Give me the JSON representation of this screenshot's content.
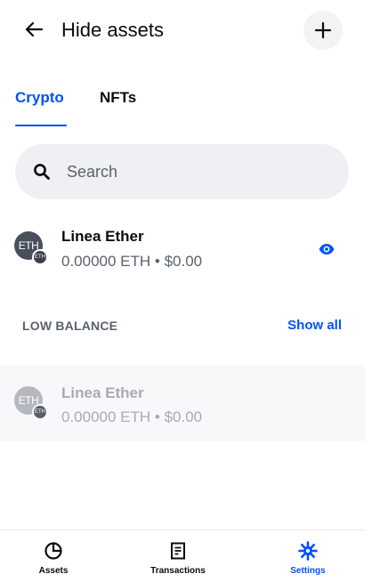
{
  "header": {
    "title": "Hide assets",
    "back_icon": "arrow-left-icon",
    "add_icon": "plus-icon"
  },
  "tabs": [
    {
      "label": "Crypto",
      "active": true
    },
    {
      "label": "NFTs",
      "active": false
    }
  ],
  "search": {
    "placeholder": "Search",
    "value": "",
    "icon": "search-icon"
  },
  "assets": [
    {
      "icon_text": "ETH",
      "network_text": "ETH",
      "name": "Linea Ether",
      "balance": "0.00000 ETH • $0.00",
      "visibility_icon": "eye-icon"
    }
  ],
  "low_balance": {
    "title": "LOW BALANCE",
    "show_all_label": "Show all",
    "assets": [
      {
        "icon_text": "ETH",
        "network_text": "ETH",
        "name": "Linea Ether",
        "balance": "0.00000 ETH • $0.00"
      }
    ]
  },
  "bottom_nav": [
    {
      "label": "Assets",
      "icon": "pie-chart-icon",
      "active": false
    },
    {
      "label": "Transactions",
      "icon": "document-icon",
      "active": false
    },
    {
      "label": "Settings",
      "icon": "gear-icon",
      "active": true
    }
  ],
  "colors": {
    "accent": "#0052ff",
    "text_primary": "#0a0b0d",
    "text_secondary": "#5b616e",
    "search_bg": "#eef0f3"
  }
}
